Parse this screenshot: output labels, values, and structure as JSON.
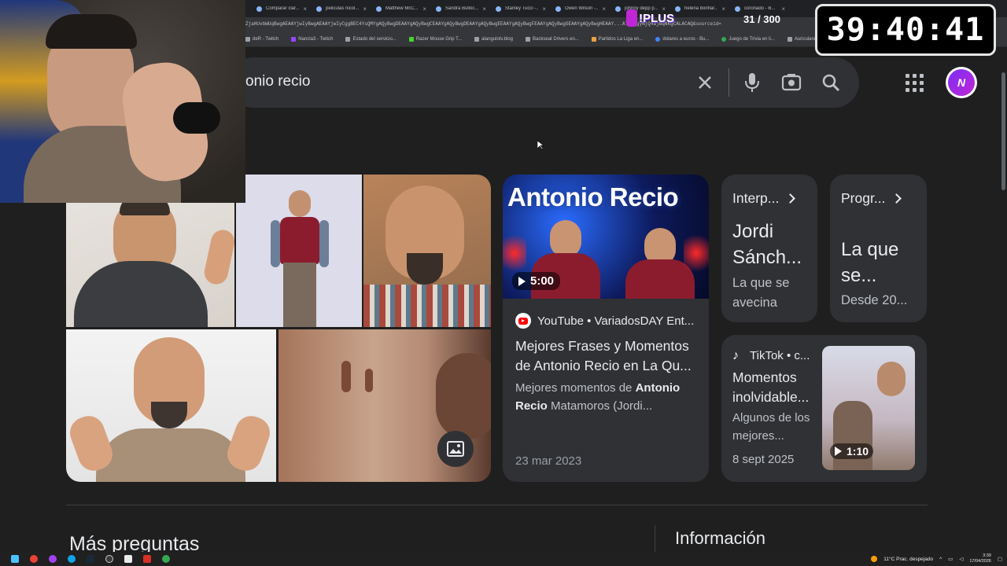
{
  "browser": {
    "tabs": [
      {
        "label": "Comparar clar..."
      },
      {
        "label": "peliculas nicol..."
      },
      {
        "label": "Matthew McC..."
      },
      {
        "label": "Sandra Bulloc..."
      },
      {
        "label": "Stanley Tucci -..."
      },
      {
        "label": "Owen Wilson -..."
      },
      {
        "label": "johnny depp p..."
      },
      {
        "label": "helena bonhar..."
      },
      {
        "label": "coronado - B..."
      }
    ],
    "url_fragment": "ZjaHUvbWUqBwgAEAAYjwIyBwgAEAAYjwIyCggBEC4YsQMYgAQyBwgDEAAYgAQyBwgCEAAYgAQyBwgDEAAYgAQyBwgEEAAYgAQyBwgFEAAYgAQyBwgGEAAYgAQyBwgHEAAY...ATSAQgyNjQ4ajBqNKgCALACAQ&sourceid=",
    "bookmarks": [
      {
        "label": "deR - Twitch"
      },
      {
        "label": "Nancla3 - Twitch"
      },
      {
        "label": "Estado del servicio..."
      },
      {
        "label": "Razer Mouse Grip T..."
      },
      {
        "label": "alangulotv.blog"
      },
      {
        "label": "Backseat Drivers en..."
      },
      {
        "label": "Partidos La Liga en..."
      },
      {
        "label": "dolares a euros - Bu..."
      },
      {
        "label": "Juego de Trivia en li..."
      },
      {
        "label": "Auriculares Philips |..."
      }
    ]
  },
  "search": {
    "query": "onio recio",
    "icons": [
      "close-icon",
      "microphone-icon",
      "camera-icon",
      "search-icon"
    ]
  },
  "video_card": {
    "thumb_title": "Antonio Recio",
    "duration": "5:00",
    "source": "YouTube • VariadosDAY Ent...",
    "title": "Mejores Frases y Momentos de Antonio Recio en La Qu...",
    "snippet_pre": "Mejores momentos de ",
    "snippet_bold": "Antonio Recio",
    "snippet_post": " Matamoros (Jordi...",
    "date": "23 mar 2023"
  },
  "kp_cards": [
    {
      "header": "Interp...",
      "big": "Jordi Sánch...",
      "sub": "La que se avecina"
    },
    {
      "header": "Progr...",
      "big": "La que se...",
      "sub": "Desde 20..."
    }
  ],
  "tiktok_card": {
    "source": "TikTok • c...",
    "title": "Momentos inolvidable...",
    "snippet": "Algunos de los mejores...",
    "date": "8 sept 2025",
    "duration": "1:10"
  },
  "sections": {
    "more_questions": "Más preguntas",
    "info": "Información"
  },
  "overlay": {
    "timer": "39:40:41",
    "plus": "!PLUS",
    "counter": "31 / 300"
  },
  "taskbar": {
    "weather": "11°C  Prac. despejado",
    "time": "3:39",
    "date": "17/04/2026"
  },
  "colors": {
    "background": "#1f1f1f",
    "card": "#303134",
    "text": "#e8eaed",
    "muted": "#bdc1c6"
  }
}
